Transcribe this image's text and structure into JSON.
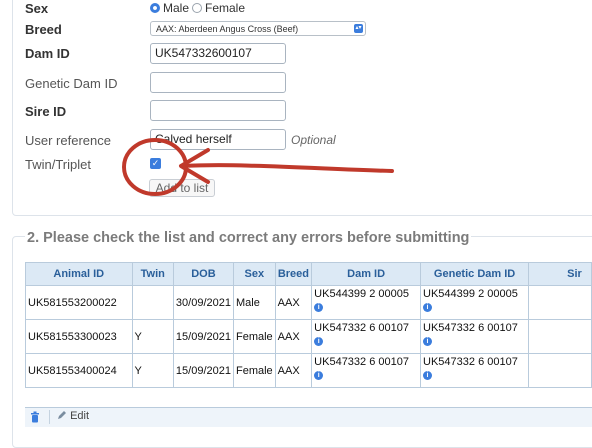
{
  "form": {
    "sex": {
      "label": "Sex",
      "options": [
        "Male",
        "Female"
      ],
      "selected": "Male"
    },
    "breed": {
      "label": "Breed",
      "value": "AAX: Aberdeen Angus Cross (Beef)"
    },
    "dam_id": {
      "label": "Dam ID",
      "value": "UK547332600107"
    },
    "genetic_dam_id": {
      "label": "Genetic Dam ID",
      "value": ""
    },
    "sire_id": {
      "label": "Sire ID",
      "value": ""
    },
    "user_reference": {
      "label": "User reference",
      "value": "Calved herself",
      "hint": "Optional"
    },
    "twin_triplet": {
      "label": "Twin/Triplet",
      "checked": true
    },
    "add_button": "Add to list"
  },
  "section2": {
    "title": "2. Please check the list and correct any errors before submitting",
    "table": {
      "columns": [
        "Animal ID",
        "Twin",
        "DOB",
        "Sex",
        "Breed",
        "Dam ID",
        "Genetic Dam ID",
        "Sir"
      ],
      "rows": [
        {
          "animal_id": "UK581553200022",
          "twin": "",
          "dob": "30/09/2021",
          "sex": "Male",
          "breed": "AAX",
          "dam_id": "UK544399 2 00005",
          "genetic_dam_id": "UK544399 2 00005",
          "sire": ""
        },
        {
          "animal_id": "UK581553300023",
          "twin": "Y",
          "dob": "15/09/2021",
          "sex": "Female",
          "breed": "AAX",
          "dam_id": "UK547332 6 00107",
          "genetic_dam_id": "UK547332 6 00107",
          "sire": ""
        },
        {
          "animal_id": "UK581553400024",
          "twin": "Y",
          "dob": "15/09/2021",
          "sex": "Female",
          "breed": "AAX",
          "dam_id": "UK547332 6 00107",
          "genetic_dam_id": "UK547332 6 00107",
          "sire": ""
        }
      ]
    },
    "toolbar": {
      "edit_label": "Edit",
      "delete_icon": "trash-icon",
      "edit_icon": "pencil-icon"
    }
  },
  "colors": {
    "accent": "#3b7ddd",
    "annotation": "#c0392b",
    "header_bg": "#dce9f5"
  }
}
